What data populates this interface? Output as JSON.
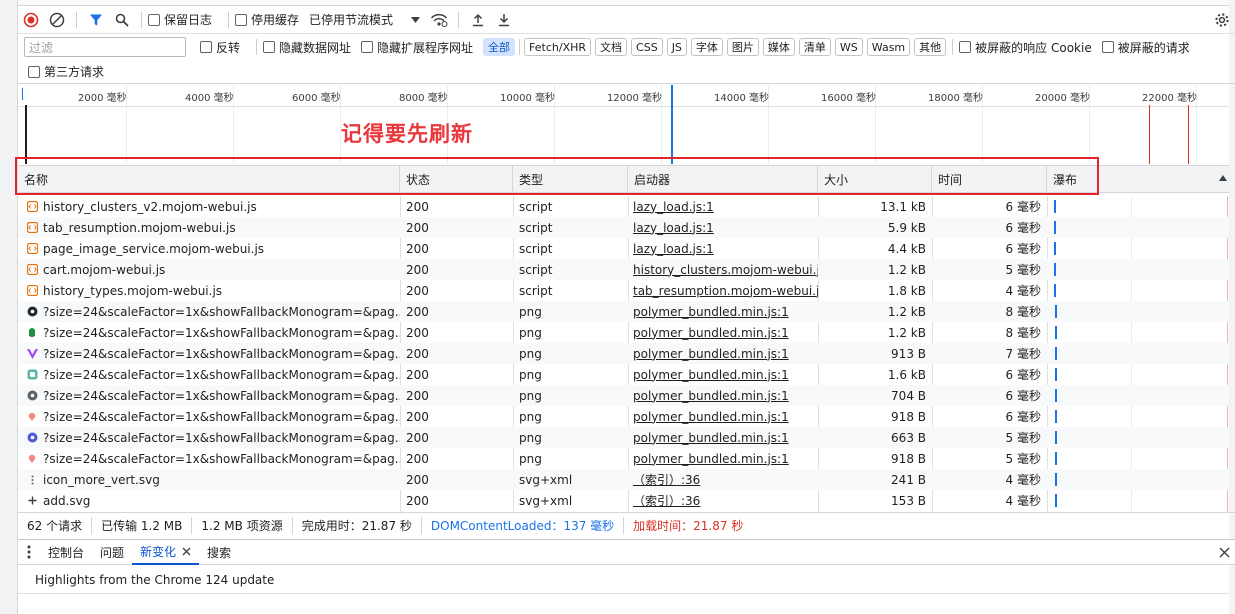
{
  "toolbar": {
    "preserve_log": "保留日志",
    "disable_cache": "停用缓存",
    "throttle": "已停用节流模式"
  },
  "filterbar": {
    "placeholder": "过滤",
    "invert": "反转",
    "hide_data_urls": "隐藏数据网址",
    "hide_ext_urls": "隐藏扩展程序网址",
    "chips": [
      "全部",
      "Fetch/XHR",
      "文档",
      "CSS",
      "JS",
      "字体",
      "图片",
      "媒体",
      "清单",
      "WS",
      "Wasm",
      "其他"
    ],
    "blocked_cookies": "被屏蔽的响应 Cookie",
    "blocked_requests": "被屏蔽的请求",
    "third_party": "第三方请求"
  },
  "overview": {
    "ticks": [
      "2000 毫秒",
      "4000 毫秒",
      "6000 毫秒",
      "8000 毫秒",
      "10000 毫秒",
      "12000 毫秒",
      "14000 毫秒",
      "16000 毫秒",
      "18000 毫秒",
      "20000 毫秒",
      "22000 毫秒"
    ],
    "annotation": "记得要先刷新"
  },
  "columns": {
    "name": "名称",
    "status": "状态",
    "type": "类型",
    "initiator": "启动器",
    "size": "大小",
    "time": "时间",
    "waterfall": "瀑布"
  },
  "rows": [
    {
      "name": "history_clusters_v2.mojom-webui.js",
      "status": "200",
      "type": "script",
      "initiator": "lazy_load.js:1",
      "size": "13.1 kB",
      "time": "6 毫秒",
      "icon": "js-file-icon",
      "color": "#e8710a"
    },
    {
      "name": "tab_resumption.mojom-webui.js",
      "status": "200",
      "type": "script",
      "initiator": "lazy_load.js:1",
      "size": "5.9 kB",
      "time": "6 毫秒",
      "icon": "js-file-icon",
      "color": "#e8710a"
    },
    {
      "name": "page_image_service.mojom-webui.js",
      "status": "200",
      "type": "script",
      "initiator": "lazy_load.js:1",
      "size": "4.4 kB",
      "time": "6 毫秒",
      "icon": "js-file-icon",
      "color": "#e8710a"
    },
    {
      "name": "cart.mojom-webui.js",
      "status": "200",
      "type": "script",
      "initiator": "history_clusters.mojom-webui.js",
      "size": "1.2 kB",
      "time": "5 毫秒",
      "icon": "js-file-icon",
      "color": "#e8710a"
    },
    {
      "name": "history_types.mojom-webui.js",
      "status": "200",
      "type": "script",
      "initiator": "tab_resumption.mojom-webui.js",
      "size": "1.8 kB",
      "time": "4 毫秒",
      "icon": "js-file-icon",
      "color": "#e8710a"
    },
    {
      "name": "?size=24&scaleFactor=1x&showFallbackMonogram=&pag...",
      "status": "200",
      "type": "png",
      "initiator": "polymer_bundled.min.js:1",
      "size": "1.2 kB",
      "time": "8 毫秒",
      "icon": "github-favicon-icon",
      "color": "#24292f"
    },
    {
      "name": "?size=24&scaleFactor=1x&showFallbackMonogram=&pag...",
      "status": "200",
      "type": "png",
      "initiator": "polymer_bundled.min.js:1",
      "size": "1.2 kB",
      "time": "8 毫秒",
      "icon": "green-favicon-icon",
      "color": "#1e8e3e"
    },
    {
      "name": "?size=24&scaleFactor=1x&showFallbackMonogram=&pag...",
      "status": "200",
      "type": "png",
      "initiator": "polymer_bundled.min.js:1",
      "size": "913 B",
      "time": "7 毫秒",
      "icon": "vue-favicon-icon",
      "color": "#a142f4"
    },
    {
      "name": "?size=24&scaleFactor=1x&showFallbackMonogram=&pag...",
      "status": "200",
      "type": "png",
      "initiator": "polymer_bundled.min.js:1",
      "size": "1.6 kB",
      "time": "6 毫秒",
      "icon": "teal-favicon-icon",
      "color": "#5bb7a5"
    },
    {
      "name": "?size=24&scaleFactor=1x&showFallbackMonogram=&pag...",
      "status": "200",
      "type": "png",
      "initiator": "polymer_bundled.min.js:1",
      "size": "704 B",
      "time": "6 毫秒",
      "icon": "gray-favicon-icon",
      "color": "#5f6368"
    },
    {
      "name": "?size=24&scaleFactor=1x&showFallbackMonogram=&pag...",
      "status": "200",
      "type": "png",
      "initiator": "polymer_bundled.min.js:1",
      "size": "918 B",
      "time": "6 毫秒",
      "icon": "pink-favicon-icon",
      "color": "#f28b82"
    },
    {
      "name": "?size=24&scaleFactor=1x&showFallbackMonogram=&pag...",
      "status": "200",
      "type": "png",
      "initiator": "polymer_bundled.min.js:1",
      "size": "663 B",
      "time": "5 毫秒",
      "icon": "blue-favicon-icon",
      "color": "#4f5bd5"
    },
    {
      "name": "?size=24&scaleFactor=1x&showFallbackMonogram=&pag...",
      "status": "200",
      "type": "png",
      "initiator": "polymer_bundled.min.js:1",
      "size": "918 B",
      "time": "5 毫秒",
      "icon": "pink-favicon-icon",
      "color": "#f28b82"
    },
    {
      "name": "icon_more_vert.svg",
      "status": "200",
      "type": "svg+xml",
      "initiator": "（索引）:36",
      "size": "241 B",
      "time": "4 毫秒",
      "icon": "more-vert-icon",
      "color": "#5f6368"
    },
    {
      "name": "add.svg",
      "status": "200",
      "type": "svg+xml",
      "initiator": "（索引）:36",
      "size": "153 B",
      "time": "4 毫秒",
      "icon": "add-icon",
      "color": "#3c4043"
    }
  ],
  "statusbar": {
    "requests": "62 个请求",
    "transferred": "已传输 1.2 MB",
    "resources": "1.2 MB 项资源",
    "finish": "完成用时：21.87 秒",
    "dcl": "DOMContentLoaded：137 毫秒",
    "load": "加载时间：21.87 秒",
    "dcl_color": "#1a73e8",
    "load_color": "#d93025"
  },
  "drawer": {
    "tabs": [
      "控制台",
      "问题",
      "新变化",
      "搜索"
    ],
    "body": "Highlights from the Chrome 124 update"
  }
}
